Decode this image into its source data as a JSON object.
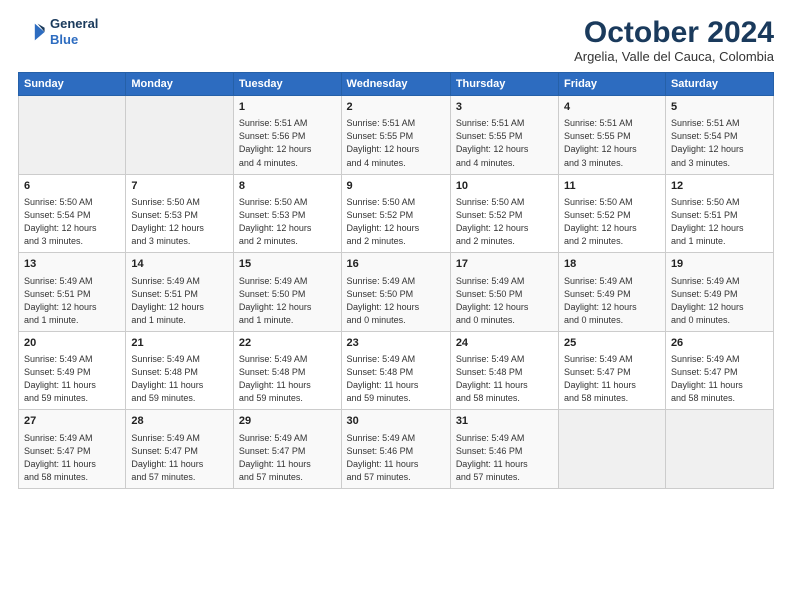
{
  "logo": {
    "line1": "General",
    "line2": "Blue"
  },
  "title": "October 2024",
  "subtitle": "Argelia, Valle del Cauca, Colombia",
  "weekdays": [
    "Sunday",
    "Monday",
    "Tuesday",
    "Wednesday",
    "Thursday",
    "Friday",
    "Saturday"
  ],
  "weeks": [
    [
      {
        "day": "",
        "info": ""
      },
      {
        "day": "",
        "info": ""
      },
      {
        "day": "1",
        "info": "Sunrise: 5:51 AM\nSunset: 5:56 PM\nDaylight: 12 hours\nand 4 minutes."
      },
      {
        "day": "2",
        "info": "Sunrise: 5:51 AM\nSunset: 5:55 PM\nDaylight: 12 hours\nand 4 minutes."
      },
      {
        "day": "3",
        "info": "Sunrise: 5:51 AM\nSunset: 5:55 PM\nDaylight: 12 hours\nand 4 minutes."
      },
      {
        "day": "4",
        "info": "Sunrise: 5:51 AM\nSunset: 5:55 PM\nDaylight: 12 hours\nand 3 minutes."
      },
      {
        "day": "5",
        "info": "Sunrise: 5:51 AM\nSunset: 5:54 PM\nDaylight: 12 hours\nand 3 minutes."
      }
    ],
    [
      {
        "day": "6",
        "info": "Sunrise: 5:50 AM\nSunset: 5:54 PM\nDaylight: 12 hours\nand 3 minutes."
      },
      {
        "day": "7",
        "info": "Sunrise: 5:50 AM\nSunset: 5:53 PM\nDaylight: 12 hours\nand 3 minutes."
      },
      {
        "day": "8",
        "info": "Sunrise: 5:50 AM\nSunset: 5:53 PM\nDaylight: 12 hours\nand 2 minutes."
      },
      {
        "day": "9",
        "info": "Sunrise: 5:50 AM\nSunset: 5:52 PM\nDaylight: 12 hours\nand 2 minutes."
      },
      {
        "day": "10",
        "info": "Sunrise: 5:50 AM\nSunset: 5:52 PM\nDaylight: 12 hours\nand 2 minutes."
      },
      {
        "day": "11",
        "info": "Sunrise: 5:50 AM\nSunset: 5:52 PM\nDaylight: 12 hours\nand 2 minutes."
      },
      {
        "day": "12",
        "info": "Sunrise: 5:50 AM\nSunset: 5:51 PM\nDaylight: 12 hours\nand 1 minute."
      }
    ],
    [
      {
        "day": "13",
        "info": "Sunrise: 5:49 AM\nSunset: 5:51 PM\nDaylight: 12 hours\nand 1 minute."
      },
      {
        "day": "14",
        "info": "Sunrise: 5:49 AM\nSunset: 5:51 PM\nDaylight: 12 hours\nand 1 minute."
      },
      {
        "day": "15",
        "info": "Sunrise: 5:49 AM\nSunset: 5:50 PM\nDaylight: 12 hours\nand 1 minute."
      },
      {
        "day": "16",
        "info": "Sunrise: 5:49 AM\nSunset: 5:50 PM\nDaylight: 12 hours\nand 0 minutes."
      },
      {
        "day": "17",
        "info": "Sunrise: 5:49 AM\nSunset: 5:50 PM\nDaylight: 12 hours\nand 0 minutes."
      },
      {
        "day": "18",
        "info": "Sunrise: 5:49 AM\nSunset: 5:49 PM\nDaylight: 12 hours\nand 0 minutes."
      },
      {
        "day": "19",
        "info": "Sunrise: 5:49 AM\nSunset: 5:49 PM\nDaylight: 12 hours\nand 0 minutes."
      }
    ],
    [
      {
        "day": "20",
        "info": "Sunrise: 5:49 AM\nSunset: 5:49 PM\nDaylight: 11 hours\nand 59 minutes."
      },
      {
        "day": "21",
        "info": "Sunrise: 5:49 AM\nSunset: 5:48 PM\nDaylight: 11 hours\nand 59 minutes."
      },
      {
        "day": "22",
        "info": "Sunrise: 5:49 AM\nSunset: 5:48 PM\nDaylight: 11 hours\nand 59 minutes."
      },
      {
        "day": "23",
        "info": "Sunrise: 5:49 AM\nSunset: 5:48 PM\nDaylight: 11 hours\nand 59 minutes."
      },
      {
        "day": "24",
        "info": "Sunrise: 5:49 AM\nSunset: 5:48 PM\nDaylight: 11 hours\nand 58 minutes."
      },
      {
        "day": "25",
        "info": "Sunrise: 5:49 AM\nSunset: 5:47 PM\nDaylight: 11 hours\nand 58 minutes."
      },
      {
        "day": "26",
        "info": "Sunrise: 5:49 AM\nSunset: 5:47 PM\nDaylight: 11 hours\nand 58 minutes."
      }
    ],
    [
      {
        "day": "27",
        "info": "Sunrise: 5:49 AM\nSunset: 5:47 PM\nDaylight: 11 hours\nand 58 minutes."
      },
      {
        "day": "28",
        "info": "Sunrise: 5:49 AM\nSunset: 5:47 PM\nDaylight: 11 hours\nand 57 minutes."
      },
      {
        "day": "29",
        "info": "Sunrise: 5:49 AM\nSunset: 5:47 PM\nDaylight: 11 hours\nand 57 minutes."
      },
      {
        "day": "30",
        "info": "Sunrise: 5:49 AM\nSunset: 5:46 PM\nDaylight: 11 hours\nand 57 minutes."
      },
      {
        "day": "31",
        "info": "Sunrise: 5:49 AM\nSunset: 5:46 PM\nDaylight: 11 hours\nand 57 minutes."
      },
      {
        "day": "",
        "info": ""
      },
      {
        "day": "",
        "info": ""
      }
    ]
  ]
}
